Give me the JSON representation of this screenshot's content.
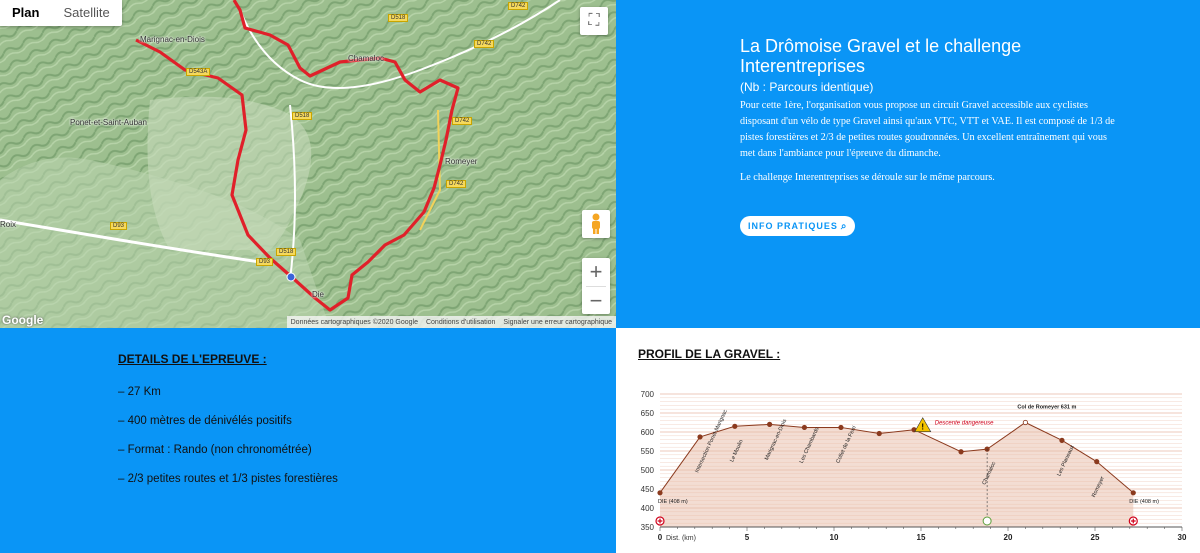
{
  "map": {
    "type_plan": "Plan",
    "type_satellite": "Satellite",
    "google": "Google",
    "attrib_data": "Données cartographiques ©2020 Google",
    "attrib_terms": "Conditions d'utilisation",
    "attrib_report": "Signaler une erreur cartographique",
    "places": [
      "Marignac-en-Diois",
      "Ponet-et-Saint-Auban",
      "Chamaloc",
      "Romeyer",
      "Die",
      "Roix"
    ],
    "roads": [
      "D518",
      "D742",
      "D543A",
      "D518",
      "D742",
      "D742",
      "D93",
      "D518",
      "D93",
      "D742"
    ],
    "route_color": "#e0202a"
  },
  "intro": {
    "title": "La Drômoise Gravel et le challenge Interentreprises",
    "subtitle": "(Nb : Parcours identique)",
    "para1": "Pour cette 1ère, l'organisation vous propose un circuit Gravel accessible aux cyclistes disposant d'un vélo de type Gravel ainsi qu'aux VTC, VTT et VAE.  Il est composé de 1/3 de pistes forestières et 2/3 de petites routes goudronnées. Un excellent entraînement qui vous met dans l'ambiance pour l'épreuve du dimanche.",
    "para2": "Le challenge Interentreprises se déroule sur le même parcours.",
    "button": "INFO PRATIQUES"
  },
  "details": {
    "title": "DETAILS DE L'EPREUVE :",
    "items": [
      "– 27 Km",
      "– 400 mètres de dénivélés positifs",
      "– Format : Rando (non chronométrée)",
      "– 2/3 petites routes et 1/3 pistes forestières"
    ]
  },
  "profile": {
    "title": "PROFIL DE LA GRAVEL :",
    "y_ticks": [
      "700",
      "650",
      "600",
      "550",
      "500",
      "450",
      "400",
      "350"
    ],
    "x_ticks": [
      "0",
      "5",
      "10",
      "15",
      "20",
      "25",
      "30"
    ],
    "x_label": "Dist. (km)",
    "warning": "Descente dangereuse",
    "start_label": "DIE (408 m)",
    "end_label": "DIE (408 m)",
    "col_label": "Col de Romeyer 631 m",
    "point_labels": [
      "Intersection Ponet-Marignac",
      "Le Moulin",
      "Marignac-en-Diois",
      "Les Chambards",
      "Collet de la Ferri",
      "Chamaloc",
      "Les Planeaux",
      "Romeyer"
    ],
    "colors": {
      "line": "#8b3a1e",
      "fill": "#f3ddd3",
      "grid": "#e7b9a5",
      "warn": "#f5c400",
      "red": "#d0021b"
    }
  },
  "chart_data": {
    "type": "area",
    "title": "PROFIL DE LA GRAVEL :",
    "xlabel": "Dist. (km)",
    "ylabel": "",
    "xlim": [
      0,
      30
    ],
    "ylim": [
      350,
      700
    ],
    "series": [
      {
        "x": [
          0,
          2.3,
          4.3,
          6.3,
          8.3,
          10.4,
          12.6,
          14.6,
          17.3,
          18.8,
          21,
          23.1,
          25.1,
          27.2
        ],
        "values": [
          440,
          587,
          615,
          620,
          612,
          612,
          596,
          606,
          548,
          555,
          625,
          578,
          522,
          440
        ]
      }
    ],
    "grid": true
  }
}
